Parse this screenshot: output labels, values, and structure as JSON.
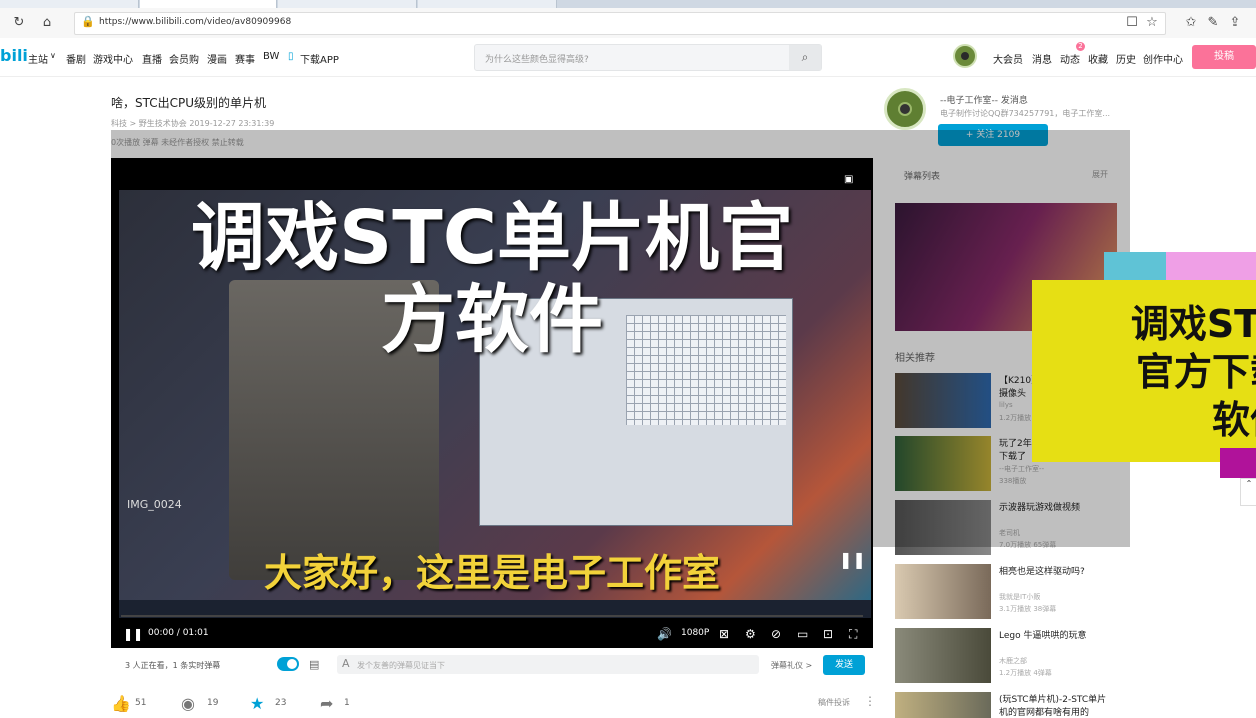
{
  "browser": {
    "url": "https://www.bilibili.com/video/av80909968"
  },
  "nav": {
    "logo": "bili",
    "items": [
      "主站",
      "番剧",
      "游戏中心",
      "直播",
      "会员购",
      "漫画",
      "赛事",
      "BW",
      "下载APP"
    ],
    "search_placeholder": "为什么这些颜色显得高级?",
    "right_items": [
      "大会员",
      "消息",
      "动态",
      "收藏",
      "历史",
      "创作中心"
    ],
    "badge": "2",
    "upload": "投稿"
  },
  "video": {
    "title": "啥，STC出CPU级别的单片机",
    "meta": "科技 > 野生技术协会     2019-12-27 23:31:39",
    "meta2": "0次播放   弹幕   未经作者授权   禁止转载",
    "big_title_line1": "调戏STC单片机官",
    "big_title_line2": "方软件",
    "file_label": "IMG_0024",
    "subtitle": "大家好，这里是电子工作室",
    "time": "00:00 / 01:01",
    "quality": "1080P"
  },
  "up": {
    "name": "--电子工作室--    发消息",
    "desc": "电子制作讨论QQ群734257791，电子工作室...",
    "follow": "+ 关注 2109"
  },
  "danmaku": {
    "head": "弹幕列表",
    "more": "展开"
  },
  "recommend": {
    "head": "相关推荐",
    "items": [
      {
        "t1": "【K210】",
        "t2": "摄像头",
        "author": "lilys",
        "stats": "1.2万播放"
      },
      {
        "t1": "玩了2年",
        "t2": "下载了",
        "author": "--电子工作室--",
        "stats": "338播放"
      },
      {
        "t1": "示波器玩游戏做视频",
        "t2": "",
        "author": "老司机",
        "stats": "7.0万播放   65弹幕"
      },
      {
        "t1": "相亮也是这样驱动吗?",
        "t2": "",
        "author": "我就是IT小贩",
        "stats": "3.1万播放   38弹幕"
      },
      {
        "t1": "Lego 牛逼哄哄的玩意",
        "t2": "",
        "author": "木鹿之部",
        "stats": "1.2万播放   4弹幕"
      },
      {
        "t1": "(玩STC单片机)-2-STC单片",
        "t2": "机的官网都有啥有用的",
        "author": "",
        "stats": ""
      }
    ]
  },
  "promo": {
    "line1": "调戏STC",
    "line2": "官方下载",
    "line3": "软件"
  },
  "underbar": {
    "viewers": "3 人正在看，1 条实时弹幕",
    "placeholder": "发个友善的弹幕见证当下",
    "etiquette": "弹幕礼仪 >",
    "send": "发送"
  },
  "actions": {
    "like": "51",
    "coin": "19",
    "fav": "23",
    "share": "1",
    "report": "稿件投诉"
  },
  "colors": {
    "accent": "#00a1d6",
    "pink": "#fb7299",
    "promo_yellow": "#e6df14"
  }
}
